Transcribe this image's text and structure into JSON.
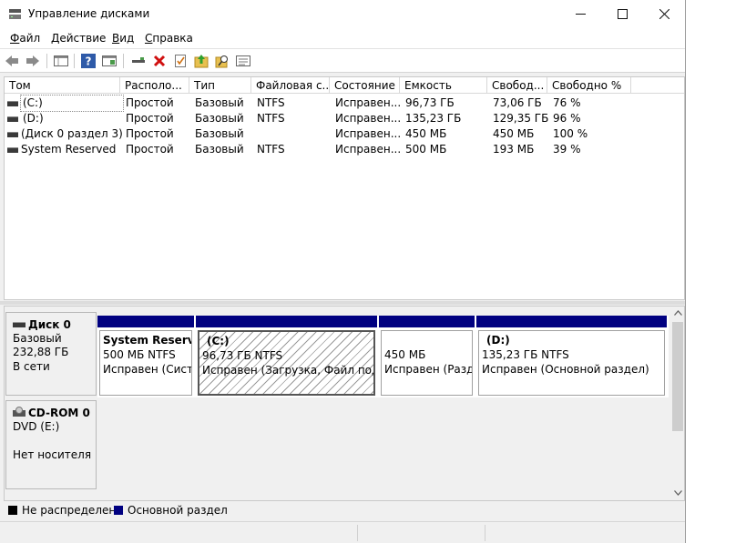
{
  "window": {
    "title": "Управление дисками"
  },
  "menu": [
    {
      "mnemonic": "Ф",
      "rest": "айл"
    },
    {
      "mnemonic": "Д",
      "rest": "ействие"
    },
    {
      "mnemonic": "В",
      "rest": "ид"
    },
    {
      "mnemonic": "С",
      "rest": "правка"
    }
  ],
  "toolbar": [
    "back-icon",
    "forward-icon",
    "console-icon",
    "help-icon",
    "properties-icon",
    "connect-icon",
    "delete-icon",
    "check-icon",
    "folder-up-icon",
    "search-icon",
    "list-icon"
  ],
  "columns": [
    "Том",
    "Располо...",
    "Тип",
    "Файловая с...",
    "Состояние",
    "Емкость",
    "Свобод...",
    "Свободно %"
  ],
  "volumes": [
    {
      "name": "(C:)",
      "layout": "Простой",
      "type": "Базовый",
      "fs": "NTFS",
      "status": "Исправен...",
      "capacity": "96,73 ГБ",
      "free": "73,06 ГБ",
      "free_pct": "76 %"
    },
    {
      "name": "(D:)",
      "layout": "Простой",
      "type": "Базовый",
      "fs": "NTFS",
      "status": "Исправен...",
      "capacity": "135,23 ГБ",
      "free": "129,35 ГБ",
      "free_pct": "96 %"
    },
    {
      "name": "(Диск 0 раздел 3)",
      "layout": "Простой",
      "type": "Базовый",
      "fs": "",
      "status": "Исправен...",
      "capacity": "450 МБ",
      "free": "450 МБ",
      "free_pct": "100 %"
    },
    {
      "name": "System Reserved",
      "layout": "Простой",
      "type": "Базовый",
      "fs": "NTFS",
      "status": "Исправен...",
      "capacity": "500 МБ",
      "free": "193 МБ",
      "free_pct": "39 %"
    }
  ],
  "disk0": {
    "name": "Диск 0",
    "type": "Базовый",
    "size": "232,88 ГБ",
    "state": "В сети",
    "partitions": [
      {
        "title": "System Reserve",
        "size": "500 МБ NTFS",
        "status": "Исправен (Систе"
      },
      {
        "title": "(C:)",
        "size": "96,73 ГБ NTFS",
        "status": "Исправен (Загрузка, Файл подкач"
      },
      {
        "title": "",
        "size": "450 МБ",
        "status": "Исправен (Разде"
      },
      {
        "title": "(D:)",
        "size": "135,23 ГБ NTFS",
        "status": "Исправен (Основной раздел)"
      }
    ]
  },
  "cdrom": {
    "name": "CD-ROM 0",
    "type": "DVD (E:)",
    "state": "Нет носителя"
  },
  "legend": [
    {
      "label": "Не распределена",
      "color": "#000000"
    },
    {
      "label": "Основной раздел",
      "color": "#000080"
    }
  ],
  "colors": {
    "partition_bar": "#000080"
  }
}
